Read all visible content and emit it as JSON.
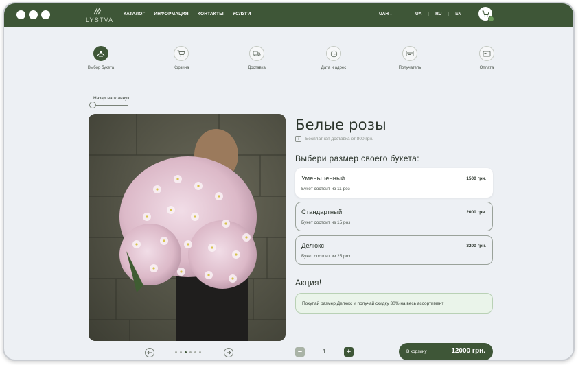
{
  "brand": {
    "name": "LYSTVA"
  },
  "nav": {
    "items": [
      "КАТАЛОГ",
      "ИНФОРМАЦИЯ",
      "КОНТАКТЫ",
      "УСЛУГИ"
    ]
  },
  "header": {
    "currency": "UAH ↓",
    "languages": [
      "UA",
      "RU",
      "EN"
    ],
    "active_language": "RU"
  },
  "steps": [
    {
      "label": "Выбор букета",
      "icon": "bouquet-icon",
      "active": true
    },
    {
      "label": "Корзина",
      "icon": "cart-icon",
      "active": false
    },
    {
      "label": "Доставка",
      "icon": "delivery-icon",
      "active": false
    },
    {
      "label": "Дата и адрес",
      "icon": "clock-icon",
      "active": false
    },
    {
      "label": "Получатель",
      "icon": "recipient-icon",
      "active": false
    },
    {
      "label": "Оплата",
      "icon": "card-icon",
      "active": false
    }
  ],
  "back_link": "Назад на главную",
  "product": {
    "title": "Белые розы",
    "shipping_note": "Бесплатная доставка от 800 грн.",
    "choose_size": "Выбери размер своего букета:",
    "options": [
      {
        "name": "Уменьшенный",
        "desc": "Букет состоит из 11 роз",
        "price": "1500 грн."
      },
      {
        "name": "Стандартный",
        "desc": "Букет состоит из 15 роз",
        "price": "2000 грн."
      },
      {
        "name": "Делюкс",
        "desc": "Букет состоит из 25 роз",
        "price": "3200 грн."
      }
    ],
    "selected_option": 0
  },
  "promo": {
    "title": "Акция!",
    "text": "Покупай размер Делюкс и получай скидку 30% на весь ассортимент"
  },
  "quantity": {
    "value": "1"
  },
  "add_to_cart": {
    "label": "В корзину",
    "total": "12000 грн."
  },
  "carousel": {
    "count": 6,
    "active": 2
  },
  "colors": {
    "primary": "#3e5637",
    "background": "#edf0f4",
    "promo_bg": "#eaf4ea"
  }
}
